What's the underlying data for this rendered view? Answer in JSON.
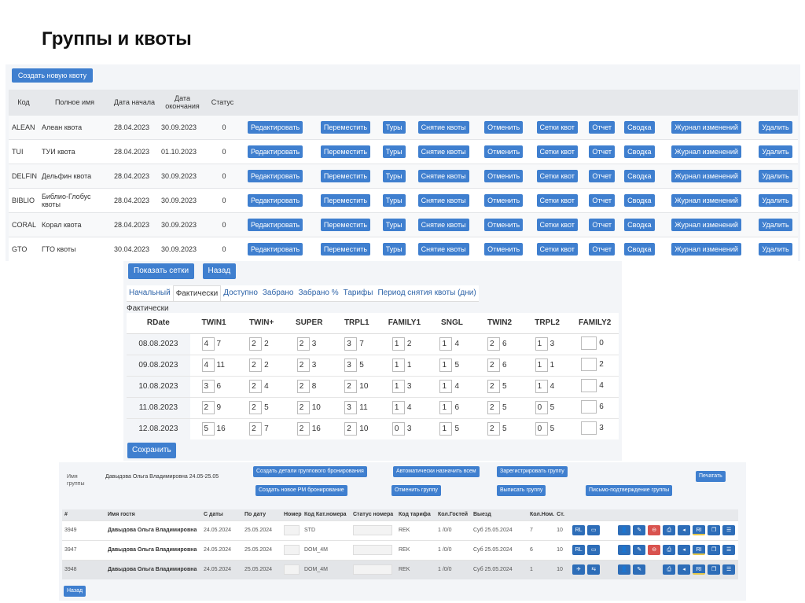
{
  "slide_title": "Группы и квоты",
  "quota_panel": {
    "create_button": "Создать новую квоту",
    "headers": [
      "Код",
      "Полное имя",
      "Дата начала",
      "Дата окончания",
      "Статус"
    ],
    "actions": [
      "Редактировать",
      "Переместить",
      "Туры",
      "Снятие квоты",
      "Отменить",
      "Сетки квот",
      "Отчет",
      "Сводка",
      "Журнал изменений",
      "Удалить"
    ],
    "rows": [
      {
        "code": "ALEAN",
        "name": "Алеан квота",
        "start": "28.04.2023",
        "end": "30.09.2023",
        "status": "0"
      },
      {
        "code": "TUI",
        "name": "ТУИ квота",
        "start": "28.04.2023",
        "end": "01.10.2023",
        "status": "0"
      },
      {
        "code": "DELFIN",
        "name": "Дельфин квота",
        "start": "28.04.2023",
        "end": "30.09.2023",
        "status": "0"
      },
      {
        "code": "BIBLIO",
        "name": "Библио-Глобус квоты",
        "start": "28.04.2023",
        "end": "30.09.2023",
        "status": "0"
      },
      {
        "code": "CORAL",
        "name": "Корал квота",
        "start": "28.04.2023",
        "end": "30.09.2023",
        "status": "0"
      },
      {
        "code": "GTO",
        "name": "ГТО квоты",
        "start": "30.04.2023",
        "end": "30.09.2023",
        "status": "0"
      }
    ]
  },
  "grid_panel": {
    "show_grids_button": "Показать сетки",
    "back_button": "Назад",
    "tabs": [
      "Начальный",
      "Фактически",
      "Доступно",
      "Забрано",
      "Забрано %",
      "Тарифы",
      "Период снятия квоты (дни)"
    ],
    "active_tab": 1,
    "subtitle": "Фактически",
    "columns": [
      "RDate",
      "TWIN1",
      "TWIN+",
      "SUPER",
      "TRPL1",
      "FAMILY1",
      "SNGL",
      "TWIN2",
      "TRPL2",
      "FAMILY2"
    ],
    "rows": [
      {
        "date": "08.08.2023",
        "cells": [
          [
            "4",
            "7"
          ],
          [
            "2",
            "2"
          ],
          [
            "2",
            "3"
          ],
          [
            "3",
            "7"
          ],
          [
            "1",
            "2"
          ],
          [
            "1",
            "4"
          ],
          [
            "2",
            "6"
          ],
          [
            "1",
            "3"
          ],
          [
            "",
            "0"
          ]
        ]
      },
      {
        "date": "09.08.2023",
        "cells": [
          [
            "4",
            "11"
          ],
          [
            "2",
            "2"
          ],
          [
            "2",
            "3"
          ],
          [
            "3",
            "5"
          ],
          [
            "1",
            "1"
          ],
          [
            "1",
            "5"
          ],
          [
            "2",
            "6"
          ],
          [
            "1",
            "1"
          ],
          [
            "",
            "2"
          ]
        ]
      },
      {
        "date": "10.08.2023",
        "cells": [
          [
            "3",
            "6"
          ],
          [
            "2",
            "4"
          ],
          [
            "2",
            "8"
          ],
          [
            "2",
            "10"
          ],
          [
            "1",
            "3"
          ],
          [
            "1",
            "4"
          ],
          [
            "2",
            "5"
          ],
          [
            "1",
            "4"
          ],
          [
            "",
            "4"
          ]
        ]
      },
      {
        "date": "11.08.2023",
        "cells": [
          [
            "2",
            "9"
          ],
          [
            "2",
            "5"
          ],
          [
            "2",
            "10"
          ],
          [
            "3",
            "11"
          ],
          [
            "1",
            "4"
          ],
          [
            "1",
            "6"
          ],
          [
            "2",
            "5"
          ],
          [
            "0",
            "5"
          ],
          [
            "",
            "6"
          ]
        ]
      },
      {
        "date": "12.08.2023",
        "cells": [
          [
            "5",
            "16"
          ],
          [
            "2",
            "7"
          ],
          [
            "2",
            "16"
          ],
          [
            "2",
            "10"
          ],
          [
            "0",
            "3"
          ],
          [
            "1",
            "5"
          ],
          [
            "2",
            "5"
          ],
          [
            "0",
            "5"
          ],
          [
            "",
            "3"
          ]
        ]
      }
    ],
    "save_button": "Сохранить"
  },
  "group_panel": {
    "group_label": "Имя группы",
    "group_name": "Давыдова Ольга Владимировна 24.05-25.05",
    "buttons": {
      "create_details": "Создать детали группового бронирования",
      "auto_assign": "Автоматически назначить всем",
      "register": "Зарегистрировать группу",
      "print": "Печатать",
      "create_pm": "Создать новое PM бронирование",
      "cancel_group": "Отменить группу",
      "checkout_group": "Выписать группу",
      "confirm_letter": "Письмо-подтверждение группы",
      "back": "Назад"
    },
    "headers": [
      "#",
      "Имя гостя",
      "С даты",
      "По дату",
      "Номер",
      "Код Кат.номера",
      "Статус номера",
      "Код тарифа",
      "Кол.Гостей",
      "Выезд",
      "Кол.Ном.",
      "Ст."
    ],
    "rows": [
      {
        "id": "3949",
        "guest": "Давыдова Ольга Владимировна",
        "from": "24.05.2024",
        "to": "25.05.2024",
        "room": "",
        "cat": "STD",
        "rstatus": "",
        "rate": "REK",
        "guests": "1 /0/0",
        "checkout": "Суб 25.05.2024",
        "rooms": "7",
        "st": "10"
      },
      {
        "id": "3947",
        "guest": "Давыдова Ольга Владимировна",
        "from": "24.05.2024",
        "to": "25.05.2024",
        "room": "",
        "cat": "DOM_4M",
        "rstatus": "",
        "rate": "REK",
        "guests": "1 /0/0",
        "checkout": "Суб 25.05.2024",
        "rooms": "6",
        "st": "10"
      },
      {
        "id": "3948",
        "guest": "Давыдова Ольга Владимировна",
        "from": "24.05.2024",
        "to": "25.05.2024",
        "room": "",
        "cat": "DOM_4M",
        "rstatus": "",
        "rate": "REK",
        "guests": "1 /0/0",
        "checkout": "Суб 25.05.2024",
        "rooms": "1",
        "st": "10"
      }
    ]
  }
}
